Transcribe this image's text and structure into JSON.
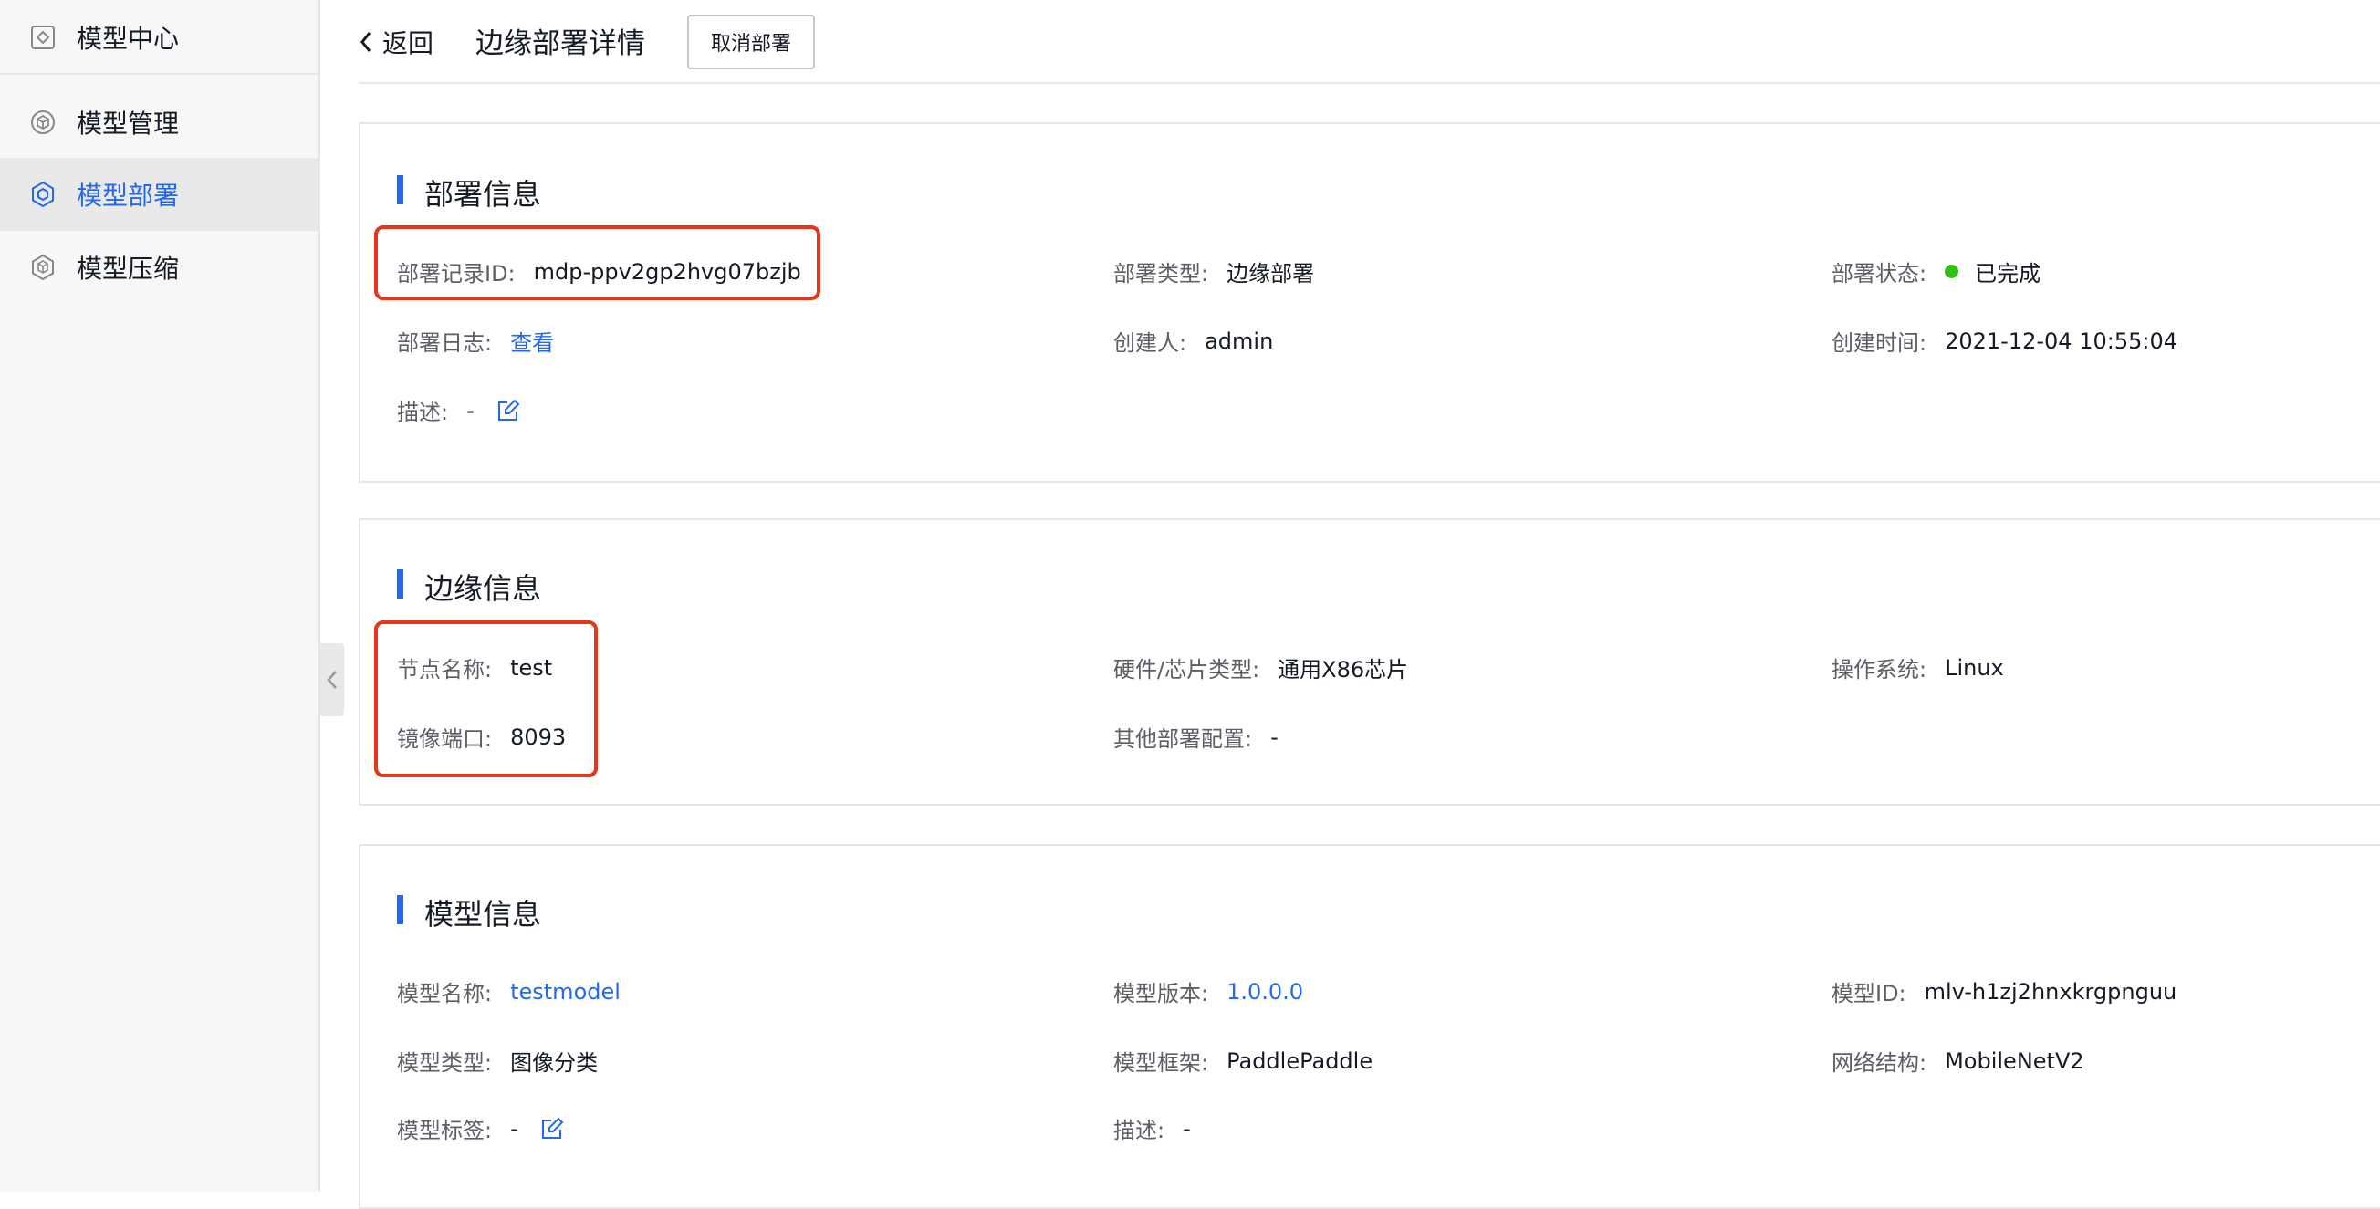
{
  "sidebar": {
    "header": "模型中心",
    "items": [
      {
        "label": "模型管理",
        "icon": "cube-icon"
      },
      {
        "label": "模型部署",
        "icon": "hexagon-icon",
        "active": true
      },
      {
        "label": "模型压缩",
        "icon": "compress-cube-icon"
      }
    ]
  },
  "topbar": {
    "back_label": "返回",
    "title": "边缘部署详情",
    "cancel_label": "取消部署"
  },
  "deploy_info": {
    "title": "部署信息",
    "record_id_label": "部署记录ID:",
    "record_id": "mdp-ppv2gp2hvg07bzjb",
    "type_label": "部署类型:",
    "type": "边缘部署",
    "status_label": "部署状态:",
    "status": "已完成",
    "log_label": "部署日志:",
    "log_link": "查看",
    "creator_label": "创建人:",
    "creator": "admin",
    "created_label": "创建时间:",
    "created": "2021-12-04 10:55:04",
    "desc_label": "描述:",
    "desc": "-"
  },
  "edge_info": {
    "title": "边缘信息",
    "node_label": "节点名称:",
    "node": "test",
    "hw_label": "硬件/芯片类型:",
    "hw": "通用X86芯片",
    "os_label": "操作系统:",
    "os": "Linux",
    "port_label": "镜像端口:",
    "port": "8093",
    "other_label": "其他部署配置:",
    "other": "-"
  },
  "model_info": {
    "title": "模型信息",
    "name_label": "模型名称:",
    "name": "testmodel",
    "version_label": "模型版本:",
    "version": "1.0.0.0",
    "id_label": "模型ID:",
    "id": "mlv-h1zj2hnxkrgpnguu",
    "type_label": "模型类型:",
    "type": "图像分类",
    "framework_label": "模型框架:",
    "framework": "PaddlePaddle",
    "network_label": "网络结构:",
    "network": "MobileNetV2",
    "tags_label": "模型标签:",
    "tags": "-",
    "desc_label": "描述:",
    "desc": "-"
  },
  "colors": {
    "accent": "#2468f2",
    "highlight": "#e8341c",
    "status_done": "#30bf13"
  }
}
